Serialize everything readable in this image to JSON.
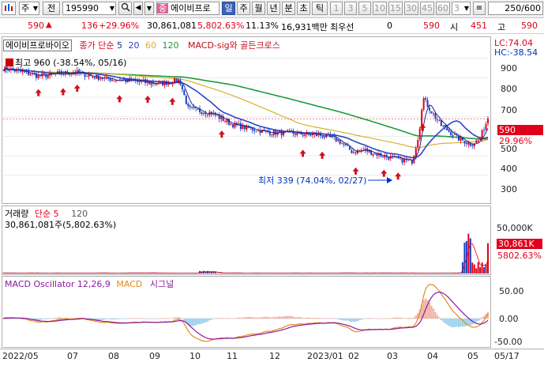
{
  "toolbar": {
    "market": "주",
    "prev_label": "전",
    "code": "195990",
    "stock_type": "중",
    "stock_name": "에이비프로",
    "periods": [
      "일",
      "주",
      "월",
      "년",
      "분",
      "초",
      "틱"
    ],
    "period_selected": "일",
    "intervals": [
      "1",
      "3",
      "5",
      "10",
      "15",
      "30",
      "45",
      "60",
      "3"
    ],
    "count": "250",
    "total": "/600"
  },
  "quote": {
    "price": "590",
    "arrow": "▲",
    "change": "136",
    "change_rate": "+29.96%",
    "volume": "30,861,081",
    "volume_rate": "5,802.63%",
    "turnover": "11.13%",
    "amount": "16,931백만",
    "best_ask_label": "최우선",
    "best_ask_value": "0",
    "price2": "590",
    "open_label": "시",
    "open_value": "451",
    "high_label": "고",
    "high_value": "590"
  },
  "price_panel": {
    "title": "에이비프로바이오",
    "ma_label": "종가 단순",
    "ma_periods": [
      "5",
      "20",
      "60",
      "120"
    ],
    "indicator_label": "MACD-sig와 골든크로스",
    "lc_label": "LC:74.04",
    "hc_label": "HC:-38.54",
    "high_annotation": "최고 960 (-38.54%, 05/16)",
    "low_annotation": "최저 339 (74.04%, 02/27)",
    "current_price_box": "590",
    "current_change_box": "29.96%",
    "y_ticks": [
      "900",
      "800",
      "700",
      "600",
      "500",
      "400",
      "300"
    ]
  },
  "volume_panel": {
    "title": "거래량",
    "ma_label": "단순 5",
    "ma_period": "120",
    "current_text": "30,861,081주(5,802.63%)",
    "y_tick": "50,000K",
    "current_box": "30,861K",
    "current_rate_box": "5802.63%"
  },
  "macd_panel": {
    "title": "MACD Oscillator 12,26,9",
    "macd_label": "MACD",
    "signal_label": "시그널",
    "y_ticks": [
      "50.00",
      "0.00",
      "-50.00"
    ]
  },
  "x_axis": [
    "2022/05",
    "07",
    "08",
    "09",
    "10",
    "11",
    "12",
    "2023/01",
    "02",
    "03",
    "04",
    "05",
    "05/17"
  ],
  "colors": {
    "up": "#e0001b",
    "down": "#1a3fc4",
    "ma5": "#1a2a8a",
    "ma20": "#2a46c8",
    "ma60": "#d6b22c",
    "ma120": "#1f9b3a",
    "macd": "#e38a20",
    "signal": "#8a1aa0",
    "osc_pos": "#f2b2a0",
    "osc_neg": "#9ed0ec"
  },
  "chart_data": {
    "type": "line",
    "title": "에이비프로바이오",
    "x": [
      "2022/05",
      "07",
      "08",
      "09",
      "10",
      "11",
      "12",
      "2023/01",
      "02",
      "03",
      "04",
      "05",
      "05/17"
    ],
    "series": [
      {
        "name": "종가",
        "values": [
          860,
          815,
          800,
          770,
          610,
          520,
          515,
          470,
          400,
          380,
          650,
          480,
          590
        ]
      },
      {
        "name": "거래량",
        "values": [
          600,
          400,
          300,
          900,
          500,
          300,
          250,
          350,
          600,
          800,
          45000,
          9000,
          30861
        ]
      },
      {
        "name": "MACD",
        "values": [
          0,
          -5,
          -10,
          10,
          -30,
          -28,
          -15,
          -22,
          -18,
          -5,
          55,
          25,
          -10
        ]
      }
    ],
    "ylim": [
      250,
      980
    ]
  }
}
